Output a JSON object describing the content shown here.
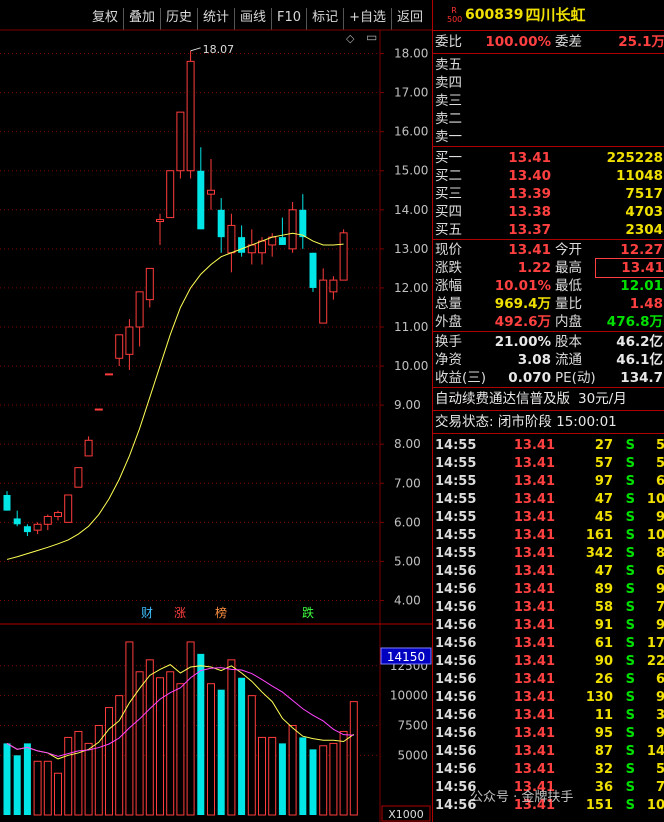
{
  "toolbar": [
    "复权",
    "叠加",
    "历史",
    "统计",
    "画线",
    "F10",
    "标记",
    "+自选",
    "返回"
  ],
  "colors": {
    "up": "#ff3c3c",
    "down": "#00e6e6",
    "ma_yellow": "#ffff55",
    "ma_magenta": "#ff44ff",
    "grid": "#7a0000",
    "axis_text": "#c0c0c0"
  },
  "chart": {
    "price_ticks": [
      "18.00",
      "17.00",
      "16.00",
      "15.00",
      "14.00",
      "13.00",
      "12.00",
      "11.00",
      "10.00",
      "9.00",
      "8.00",
      "7.00",
      "6.00",
      "5.00",
      "4.00"
    ],
    "high_label": "18.07",
    "vol_ticks": [
      "12500",
      "10000",
      "7500",
      "5000"
    ],
    "vol_cursor": "14150",
    "vol_unit": "X1000",
    "markers": [
      {
        "text": "财",
        "color": "#40c0ff"
      },
      {
        "text": "涨",
        "color": "#ff4040"
      },
      {
        "text": "榜",
        "color": "#ff9040"
      },
      {
        "text": "跌",
        "color": "#40ff40"
      }
    ]
  },
  "chart_data": {
    "type": "candlestick",
    "price_ylim": [
      3.5,
      18.5
    ],
    "candles": [
      {
        "o": 6.7,
        "h": 6.8,
        "l": 6.3,
        "c": 6.3
      },
      {
        "o": 6.1,
        "h": 6.3,
        "l": 5.9,
        "c": 5.95
      },
      {
        "o": 5.9,
        "h": 5.95,
        "l": 5.65,
        "c": 5.75
      },
      {
        "o": 5.8,
        "h": 6.0,
        "l": 5.7,
        "c": 5.95
      },
      {
        "o": 5.95,
        "h": 6.2,
        "l": 5.8,
        "c": 6.15
      },
      {
        "o": 6.15,
        "h": 6.3,
        "l": 6.05,
        "c": 6.25
      },
      {
        "o": 6.0,
        "h": 6.7,
        "l": 6.0,
        "c": 6.7
      },
      {
        "o": 6.9,
        "h": 7.4,
        "l": 6.9,
        "c": 7.4
      },
      {
        "o": 7.7,
        "h": 8.2,
        "l": 7.7,
        "c": 8.1
      },
      {
        "o": 8.9,
        "h": 8.9,
        "l": 8.9,
        "c": 8.9
      },
      {
        "o": 9.8,
        "h": 9.8,
        "l": 9.8,
        "c": 9.8
      },
      {
        "o": 10.2,
        "h": 10.8,
        "l": 10.0,
        "c": 10.8
      },
      {
        "o": 10.3,
        "h": 11.2,
        "l": 9.9,
        "c": 11.0
      },
      {
        "o": 11.0,
        "h": 11.9,
        "l": 10.5,
        "c": 11.9
      },
      {
        "o": 11.7,
        "h": 12.5,
        "l": 11.5,
        "c": 12.5
      },
      {
        "o": 13.7,
        "h": 13.9,
        "l": 13.1,
        "c": 13.75
      },
      {
        "o": 13.8,
        "h": 15.0,
        "l": 13.8,
        "c": 15.0
      },
      {
        "o": 15.0,
        "h": 16.5,
        "l": 14.8,
        "c": 16.5
      },
      {
        "o": 15.0,
        "h": 18.07,
        "l": 14.8,
        "c": 17.8
      },
      {
        "o": 15.0,
        "h": 15.6,
        "l": 13.5,
        "c": 13.5
      },
      {
        "o": 14.4,
        "h": 15.3,
        "l": 14.0,
        "c": 14.5
      },
      {
        "o": 14.0,
        "h": 14.3,
        "l": 12.9,
        "c": 13.3
      },
      {
        "o": 12.9,
        "h": 13.9,
        "l": 12.4,
        "c": 13.6
      },
      {
        "o": 13.3,
        "h": 13.6,
        "l": 12.8,
        "c": 12.9
      },
      {
        "o": 12.9,
        "h": 13.5,
        "l": 12.6,
        "c": 13.1
      },
      {
        "o": 12.9,
        "h": 13.3,
        "l": 12.6,
        "c": 13.2
      },
      {
        "o": 13.1,
        "h": 13.4,
        "l": 12.8,
        "c": 13.3
      },
      {
        "o": 13.3,
        "h": 13.8,
        "l": 13.1,
        "c": 13.1
      },
      {
        "o": 13.0,
        "h": 14.2,
        "l": 12.9,
        "c": 14.0
      },
      {
        "o": 14.0,
        "h": 14.4,
        "l": 13.0,
        "c": 13.3
      },
      {
        "o": 12.9,
        "h": 12.9,
        "l": 11.9,
        "c": 12.0
      },
      {
        "o": 11.1,
        "h": 12.5,
        "l": 11.1,
        "c": 12.2
      },
      {
        "o": 11.9,
        "h": 12.3,
        "l": 11.7,
        "c": 12.2
      },
      {
        "o": 12.2,
        "h": 13.5,
        "l": 12.2,
        "c": 13.41
      }
    ],
    "ma_yellow": [
      5.05,
      5.12,
      5.2,
      5.28,
      5.36,
      5.45,
      5.55,
      5.7,
      5.9,
      6.2,
      6.6,
      7.1,
      7.7,
      8.4,
      9.2,
      10.0,
      10.8,
      11.5,
      12.0,
      12.35,
      12.6,
      12.8,
      12.9,
      13.0,
      13.1,
      13.2,
      13.3,
      13.35,
      13.4,
      13.35,
      13.2,
      13.1,
      13.1,
      13.12
    ],
    "volumes": [
      6000,
      5000,
      6000,
      4500,
      4500,
      3500,
      6500,
      7000,
      6000,
      7500,
      9000,
      10000,
      14500,
      12000,
      13000,
      11500,
      12000,
      11000,
      14500,
      13500,
      11000,
      10500,
      13000,
      11500,
      10000,
      6500,
      6500,
      6000,
      7500,
      6500,
      5500,
      5800,
      6000,
      7000,
      9500
    ],
    "vol_ylim": [
      0,
      15500
    ]
  },
  "panel": {
    "badge_top": "R",
    "badge_bottom": "500",
    "code": "600839",
    "name": "四川长虹",
    "weibi_label": "委比",
    "weibi_value": "100.00%",
    "weicha_label": "委差",
    "weicha_value": "25.1万",
    "sell_labels": [
      "卖五",
      "卖四",
      "卖三",
      "卖二",
      "卖一"
    ],
    "buys": [
      {
        "label": "买一",
        "price": "13.41",
        "vol": "225228"
      },
      {
        "label": "买二",
        "price": "13.40",
        "vol": "11048"
      },
      {
        "label": "买三",
        "price": "13.39",
        "vol": "7517"
      },
      {
        "label": "买四",
        "price": "13.38",
        "vol": "4703"
      },
      {
        "label": "买五",
        "price": "13.37",
        "vol": "2304"
      }
    ],
    "quote": [
      {
        "l1": "现价",
        "v1": "13.41",
        "l2": "今开",
        "v2": "12.27",
        "c1": "red",
        "c2": "red"
      },
      {
        "l1": "涨跌",
        "v1": "1.22",
        "l2": "最高",
        "v2": "13.41",
        "c1": "red",
        "c2": "red"
      },
      {
        "l1": "涨幅",
        "v1": "10.01%",
        "l2": "最低",
        "v2": "12.01",
        "c1": "red",
        "c2": "green"
      },
      {
        "l1": "总量",
        "v1": "969.4万",
        "l2": "量比",
        "v2": "1.48",
        "c1": "yellow",
        "c2": "red"
      },
      {
        "l1": "外盘",
        "v1": "492.6万",
        "l2": "内盘",
        "v2": "476.8万",
        "c1": "red",
        "c2": "green"
      }
    ],
    "stats": [
      {
        "l1": "换手",
        "v1": "21.00%",
        "l2": "股本",
        "v2": "46.2亿"
      },
      {
        "l1": "净资",
        "v1": "3.08",
        "l2": "流通",
        "v2": "46.1亿"
      },
      {
        "l1": "收益(三)",
        "v1": "0.070",
        "l2": "PE(动)",
        "v2": "134.7"
      }
    ],
    "promo": "自动续费通达信普及版",
    "promo_price": "30元/月",
    "status": "交易状态: 闭市阶段 15:00:01",
    "ticks": [
      {
        "t": "14:55",
        "p": "13.41",
        "v": "27",
        "d": "S",
        "n": "5"
      },
      {
        "t": "14:55",
        "p": "13.41",
        "v": "57",
        "d": "S",
        "n": "5"
      },
      {
        "t": "14:55",
        "p": "13.41",
        "v": "97",
        "d": "S",
        "n": "6"
      },
      {
        "t": "14:55",
        "p": "13.41",
        "v": "47",
        "d": "S",
        "n": "10"
      },
      {
        "t": "14:55",
        "p": "13.41",
        "v": "45",
        "d": "S",
        "n": "9"
      },
      {
        "t": "14:55",
        "p": "13.41",
        "v": "161",
        "d": "S",
        "n": "10"
      },
      {
        "t": "14:55",
        "p": "13.41",
        "v": "342",
        "d": "S",
        "n": "8"
      },
      {
        "t": "14:56",
        "p": "13.41",
        "v": "47",
        "d": "S",
        "n": "6"
      },
      {
        "t": "14:56",
        "p": "13.41",
        "v": "89",
        "d": "S",
        "n": "9"
      },
      {
        "t": "14:56",
        "p": "13.41",
        "v": "58",
        "d": "S",
        "n": "7"
      },
      {
        "t": "14:56",
        "p": "13.41",
        "v": "91",
        "d": "S",
        "n": "9"
      },
      {
        "t": "14:56",
        "p": "13.41",
        "v": "61",
        "d": "S",
        "n": "17"
      },
      {
        "t": "14:56",
        "p": "13.41",
        "v": "90",
        "d": "S",
        "n": "22"
      },
      {
        "t": "14:56",
        "p": "13.41",
        "v": "26",
        "d": "S",
        "n": "6"
      },
      {
        "t": "14:56",
        "p": "13.41",
        "v": "130",
        "d": "S",
        "n": "9"
      },
      {
        "t": "14:56",
        "p": "13.41",
        "v": "11",
        "d": "S",
        "n": "3"
      },
      {
        "t": "14:56",
        "p": "13.41",
        "v": "95",
        "d": "S",
        "n": "9"
      },
      {
        "t": "14:56",
        "p": "13.41",
        "v": "87",
        "d": "S",
        "n": "14"
      },
      {
        "t": "14:56",
        "p": "13.41",
        "v": "32",
        "d": "S",
        "n": "5"
      },
      {
        "t": "14:56",
        "p": "13.41",
        "v": "36",
        "d": "S",
        "n": "7"
      },
      {
        "t": "14:56",
        "p": "13.41",
        "v": "151",
        "d": "S",
        "n": "10"
      }
    ]
  },
  "watermark": "公众号 · 金牌扶手"
}
